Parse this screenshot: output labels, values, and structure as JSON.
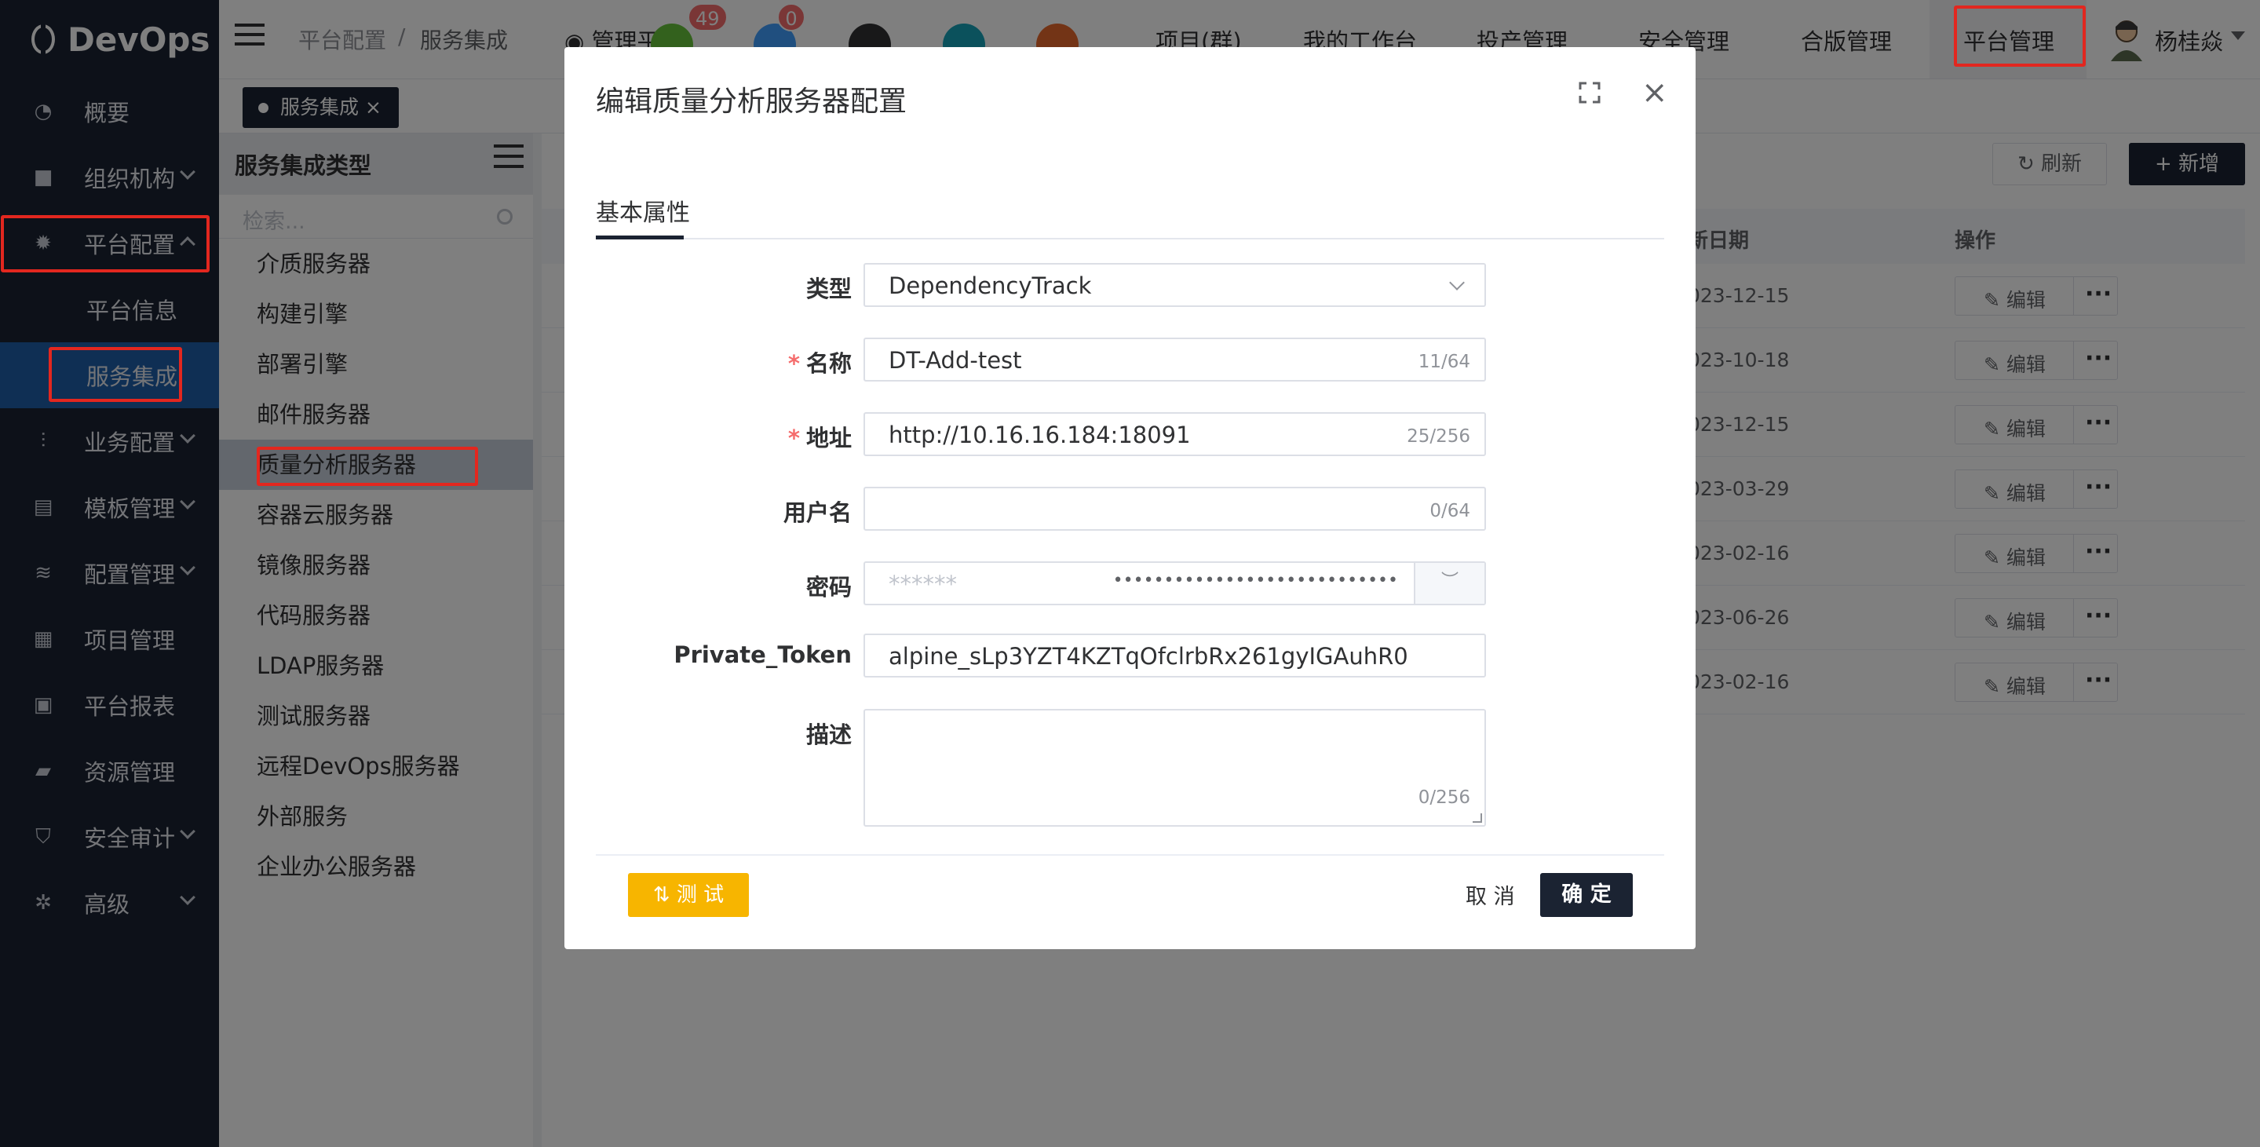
{
  "app": {
    "logo_text": "DevOps"
  },
  "sidebar": {
    "items": [
      {
        "label": "概要",
        "icon": "gauge-icon"
      },
      {
        "label": "组织机构",
        "icon": "lock-icon"
      },
      {
        "label": "平台配置",
        "icon": "gear-icon"
      },
      {
        "label": "平台信息"
      },
      {
        "label": "服务集成"
      },
      {
        "label": "业务配置",
        "icon": "sliders-icon"
      },
      {
        "label": "模板管理",
        "icon": "template-icon"
      },
      {
        "label": "配置管理",
        "icon": "database-icon"
      },
      {
        "label": "项目管理",
        "icon": "grid-icon"
      },
      {
        "label": "平台报表",
        "icon": "monitor-icon"
      },
      {
        "label": "资源管理",
        "icon": "folder-icon"
      },
      {
        "label": "安全审计",
        "icon": "shield-icon"
      },
      {
        "label": "高级",
        "icon": "advanced-icon"
      }
    ]
  },
  "header": {
    "breadcrumb": [
      "平台配置",
      "/",
      "服务集成"
    ],
    "manage_label": "管理平台",
    "badges": [
      "49",
      "0"
    ],
    "nav": [
      "项目(群)",
      "我的工作台",
      "投产管理",
      "安全管理",
      "合版管理",
      "平台管理"
    ],
    "user": "杨桂焱"
  },
  "tags": {
    "active": "服务集成"
  },
  "type_panel": {
    "title": "服务集成类型",
    "search_placeholder": "检索...",
    "items": [
      "介质服务器",
      "构建引擎",
      "部署引擎",
      "邮件服务器",
      "质量分析服务器",
      "容器云服务器",
      "镜像服务器",
      "代码服务器",
      "LDAP服务器",
      "测试服务器",
      "远程DevOps服务器",
      "外部服务",
      "企业办公服务器"
    ]
  },
  "main": {
    "refresh_label": "刷新",
    "add_label": "新增",
    "columns": {
      "date": "新日期",
      "ops": "操作"
    },
    "rows": [
      "023-12-15",
      "023-10-18",
      "023-12-15",
      "023-03-29",
      "023-02-16",
      "023-06-26",
      "023-02-16"
    ],
    "edit_label": "编辑"
  },
  "dialog": {
    "title": "编辑质量分析服务器配置",
    "tab": "基本属性",
    "fields": {
      "type": {
        "label": "类型",
        "value": "DependencyTrack"
      },
      "name": {
        "label": "名称",
        "value": "DT-Add-test",
        "count": "11/64"
      },
      "address": {
        "label": "地址",
        "value": "http://10.16.16.184:18091",
        "count": "25/256"
      },
      "username": {
        "label": "用户名",
        "value": "",
        "count": "0/64"
      },
      "password": {
        "label": "密码",
        "placeholder": "******",
        "masked": "••••••••••••••••••••••••••••"
      },
      "token": {
        "label": "Private_Token",
        "value": "alpine_sLp3YZT4KZTqOfclrbRx261gyIGAuhR0"
      },
      "description": {
        "label": "描述",
        "count": "0/256"
      }
    },
    "test_label": "测 试",
    "cancel_label": "取 消",
    "ok_label": "确 定"
  },
  "colors": {
    "sidebar_bg": "#1b2332",
    "accent": "#1f5fa8",
    "highlight": "#e2271f",
    "warning": "#f7b500"
  }
}
